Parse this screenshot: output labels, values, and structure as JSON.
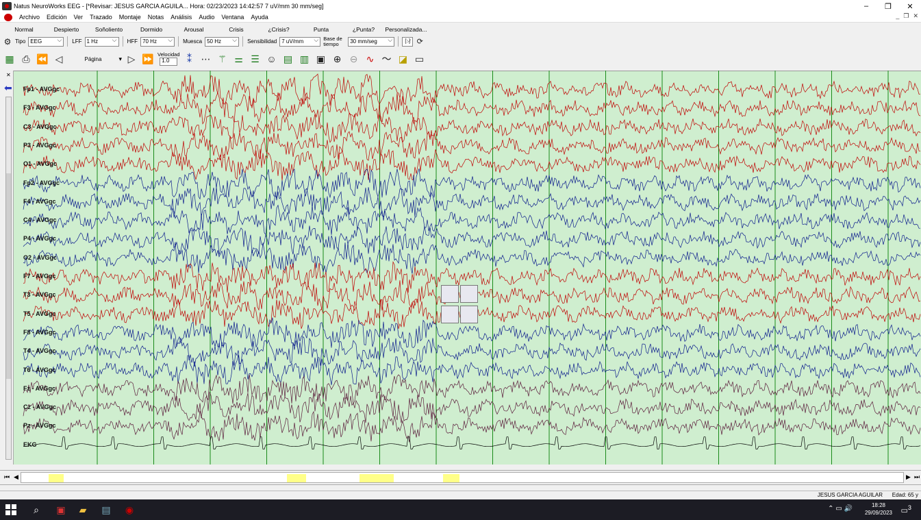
{
  "window": {
    "title": "Natus NeuroWorks EEG - [*Revisar:   JESUS  GARCIA AGUILA...   Hora: 02/23/2023 14:42:57   7 uV/mm   30 mm/seg]",
    "controls": [
      "–",
      "❐",
      "✕"
    ]
  },
  "menu": {
    "items": [
      "Archivo",
      "Edición",
      "Ver",
      "Trazado",
      "Montaje",
      "Notas",
      "Análisis",
      "Audio",
      "Ventana",
      "Ayuda"
    ]
  },
  "montage_presets": [
    "Normal",
    "Despierto",
    "Soñoliento",
    "Dormido",
    "Arousal",
    "Crisis",
    "¿Crisis?",
    "Punta",
    "¿Punta?",
    "Personalizada..."
  ],
  "settings": {
    "tipo_label": "Tipo",
    "tipo_value": "EEG",
    "lff_label": "LFF",
    "lff_value": "1 Hz",
    "hff_label": "HFF",
    "hff_value": "70 Hz",
    "muesca_label": "Muesca",
    "muesca_value": "50 Hz",
    "sensibilidad_label": "Sensibilidad",
    "sensibilidad_value": "7 uV/mm",
    "base_tiempo_label": "Base de tiempo",
    "base_tiempo_value": "30 mm/seg",
    "bracket_btn": "[..]",
    "refresh_btn": "⟳"
  },
  "navigation": {
    "page_label": "Página",
    "velocidad_label": "Velocidad",
    "velocidad_value": "1.0"
  },
  "channels": [
    {
      "label": "Fp1 - AVGgc",
      "color": "#c00000"
    },
    {
      "label": "F3 - AVGgc",
      "color": "#c00000"
    },
    {
      "label": "C3 - AVGgc",
      "color": "#c00000"
    },
    {
      "label": "P3 - AVGgc",
      "color": "#c00000"
    },
    {
      "label": "O1 - AVGgc",
      "color": "#c00000"
    },
    {
      "label": "Fp2 - AVGgc",
      "color": "#0a1a8c"
    },
    {
      "label": "F4 - AVGgc",
      "color": "#0a1a8c"
    },
    {
      "label": "C4 - AVGgc",
      "color": "#0a1a8c"
    },
    {
      "label": "P4 - AVGgc",
      "color": "#0a1a8c"
    },
    {
      "label": "O2 - AVGgc",
      "color": "#0a1a8c"
    },
    {
      "label": "F7 - AVGgc",
      "color": "#c00000"
    },
    {
      "label": "T3 - AVGgc",
      "color": "#c00000"
    },
    {
      "label": "T5 - AVGgc",
      "color": "#c00000"
    },
    {
      "label": "F8 - AVGgc",
      "color": "#0a1a8c"
    },
    {
      "label": "T4 - AVGgc",
      "color": "#0a1a8c"
    },
    {
      "label": "T6 - AVGgc",
      "color": "#0a1a8c"
    },
    {
      "label": "Fz - AVGgc",
      "color": "#5a1a3a"
    },
    {
      "label": "Cz - AVGgc",
      "color": "#5a1a3a"
    },
    {
      "label": "Pz - AVGgc",
      "color": "#5a1a3a"
    },
    {
      "label": "EKG",
      "color": "#000000"
    }
  ],
  "colors": {
    "eeg_background": "#cfeecf",
    "second_gridline": "#1a8a1a",
    "timeline_highlight": "#ffff88"
  },
  "status": {
    "patient": "JESUS  GARCIA AGUILAR",
    "age": "Edad: 65 y"
  },
  "taskbar": {
    "time": "18:28",
    "date": "29/09/2023",
    "notifications": "3"
  }
}
